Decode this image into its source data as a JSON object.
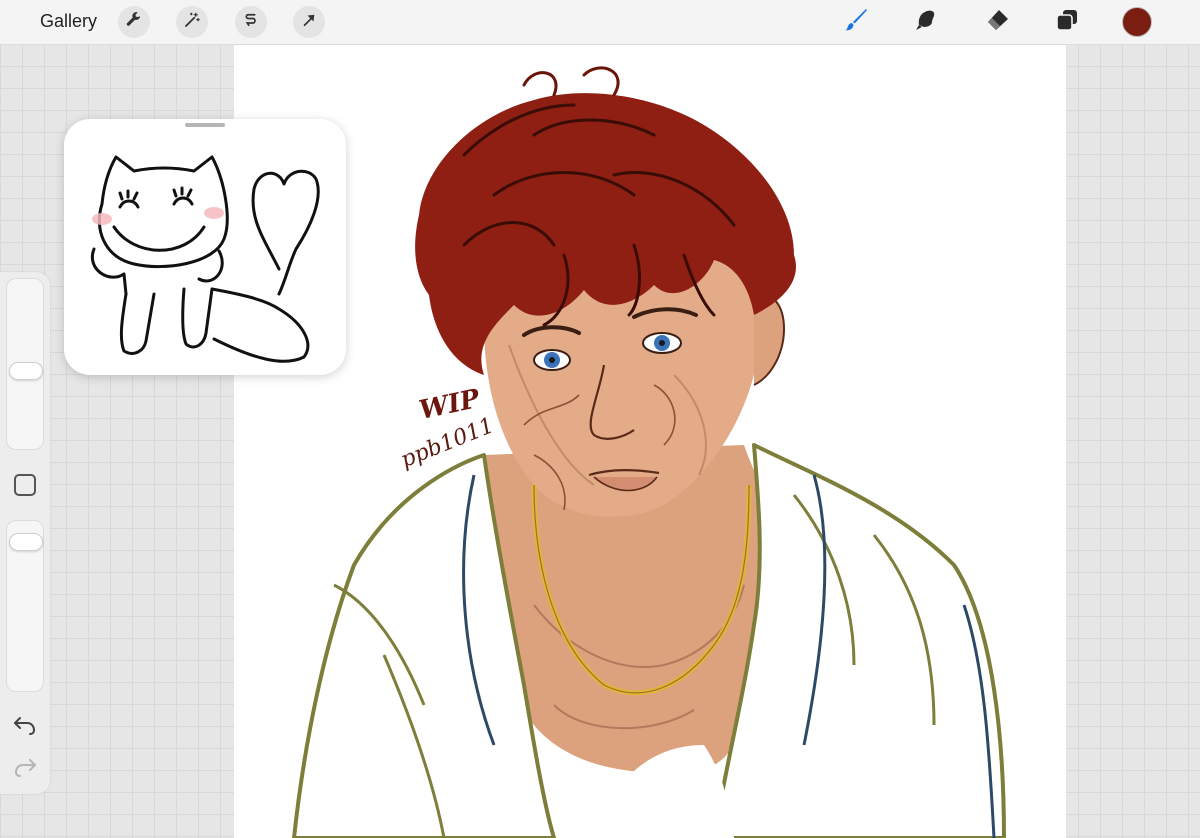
{
  "toolbar": {
    "gallery_label": "Gallery",
    "left_actions": [
      {
        "name": "wrench-icon"
      },
      {
        "name": "magic-wand-icon"
      },
      {
        "name": "selection-icon"
      },
      {
        "name": "transform-arrow-icon"
      }
    ],
    "right_tools": [
      {
        "name": "brush-icon",
        "active": true
      },
      {
        "name": "smudge-icon"
      },
      {
        "name": "eraser-icon"
      },
      {
        "name": "layers-icon"
      }
    ],
    "current_color": "#7a1e12",
    "active_tool_color": "#1a73e8"
  },
  "canvas": {
    "watermark": {
      "line1": "WIP",
      "line2": "ppb1011"
    }
  },
  "sidebar": {
    "brush_size_level": 0.55,
    "opacity_level": 0.93
  },
  "reference_window": {
    "visible": true,
    "content": "cat-doodle"
  }
}
